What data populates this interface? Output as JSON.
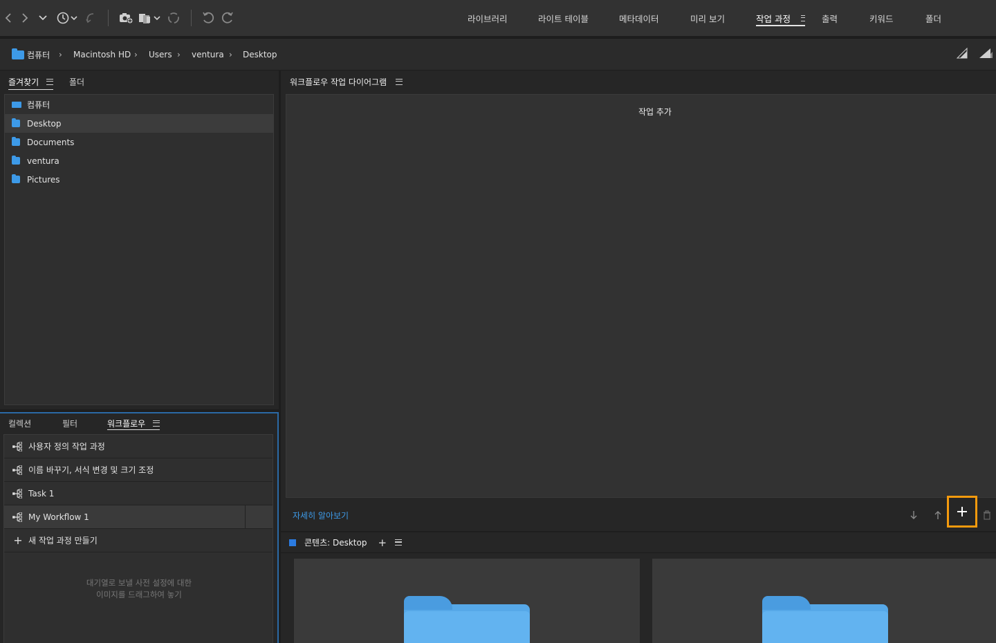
{
  "toolbar": {
    "workspaces": [
      {
        "label": "라이브러리"
      },
      {
        "label": "라이트 테이블"
      },
      {
        "label": "메타데이터"
      },
      {
        "label": "미리 보기"
      },
      {
        "label": "작업 과정"
      },
      {
        "label": "출력"
      },
      {
        "label": "키워드"
      },
      {
        "label": "폴더"
      }
    ],
    "active_workspace": "작업 과정"
  },
  "breadcrumb": [
    "컴퓨터",
    "Macintosh HD",
    "Users",
    "ventura",
    "Desktop"
  ],
  "favorites_panel": {
    "tabs": [
      "즐겨찾기",
      "폴더"
    ],
    "items": [
      {
        "label": "컴퓨터",
        "icon": "computer-icon"
      },
      {
        "label": "Desktop",
        "icon": "folder-icon"
      },
      {
        "label": "Documents",
        "icon": "folder-icon"
      },
      {
        "label": "ventura",
        "icon": "home-folder-icon"
      },
      {
        "label": "Pictures",
        "icon": "folder-icon"
      }
    ]
  },
  "workflow_panel": {
    "tabs": [
      "컬렉션",
      "필터",
      "워크플로우"
    ],
    "items": [
      {
        "label": "사용자 정의 작업 과정"
      },
      {
        "label": "이름 바꾸기, 서식 변경 및 크기 조정"
      },
      {
        "label": "Task 1"
      },
      {
        "label": "My Workflow 1"
      }
    ],
    "new_label": "새 작업 과정 만들기",
    "hint_line1": "대기열로 보낼 사전 설정에 대한",
    "hint_line2": "이미지를 드래그하여 놓기"
  },
  "diagram_panel": {
    "title": "워크플로우 작업 다이어그램",
    "add_task": "작업 추가",
    "learn_more": "자세히 알아보기"
  },
  "content_panel": {
    "title": "콘텐츠: Desktop"
  },
  "colors": {
    "accent_blue": "#3d9ae8",
    "highlight_orange": "#f59a0d"
  }
}
